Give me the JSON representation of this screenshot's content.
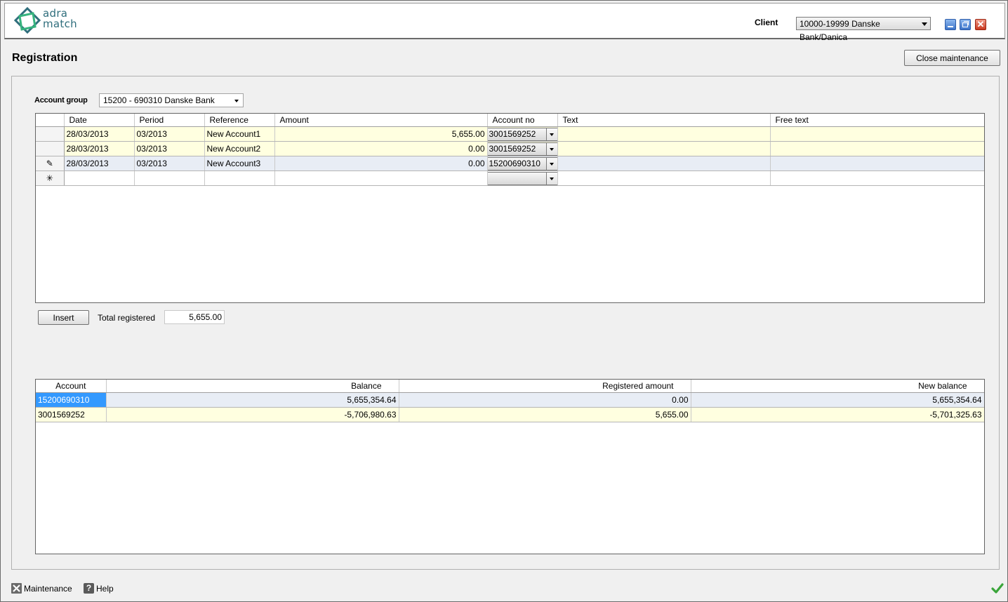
{
  "app": {
    "logo_line1": "adra",
    "logo_line2": "match",
    "client_label": "Client",
    "client_value": "10000-19999 Danske Bank/Danica",
    "close_symbol": "✕"
  },
  "page": {
    "title": "Registration",
    "close_maintenance_label": "Close maintenance"
  },
  "account_group": {
    "label": "Account group",
    "value": "15200 - 690310 Danske Bank"
  },
  "registration_grid": {
    "columns": [
      "Date",
      "Period",
      "Reference",
      "Amount",
      "Account no",
      "Text",
      "Free text"
    ],
    "rows": [
      {
        "indicator": "",
        "date": "28/03/2013",
        "period": "03/2013",
        "reference": "New Account1",
        "amount": "5,655.00",
        "account_no": "3001569252",
        "text": "",
        "free_text": ""
      },
      {
        "indicator": "",
        "date": "28/03/2013",
        "period": "03/2013",
        "reference": "New Account2",
        "amount": "0.00",
        "account_no": "3001569252",
        "text": "",
        "free_text": ""
      },
      {
        "indicator": "✎",
        "date": "28/03/2013",
        "period": "03/2013",
        "reference": "New Account3",
        "amount": "0.00",
        "account_no": "15200690310",
        "text": "",
        "free_text": ""
      }
    ],
    "new_row_indicator": "✳"
  },
  "insert_button_label": "Insert",
  "total": {
    "label": "Total registered",
    "value": "5,655.00"
  },
  "balance_grid": {
    "columns": [
      "Account",
      "Balance",
      "Registered amount",
      "New balance"
    ],
    "rows": [
      {
        "account": "15200690310",
        "balance": "5,655,354.64",
        "registered_amount": "0.00",
        "new_balance": "5,655,354.64"
      },
      {
        "account": "3001569252",
        "balance": "-5,706,980.63",
        "registered_amount": "5,655.00",
        "new_balance": "-5,701,325.63"
      }
    ]
  },
  "footer": {
    "maintenance_label": "Maintenance",
    "help_label": "Help",
    "help_glyph": "?"
  },
  "colors": {
    "row_yellow": "#ffffe0",
    "row_current": "#e8edf5",
    "selection": "#3399ff",
    "logo": "#2f6e7c",
    "ok_check": "#3aa53a"
  }
}
